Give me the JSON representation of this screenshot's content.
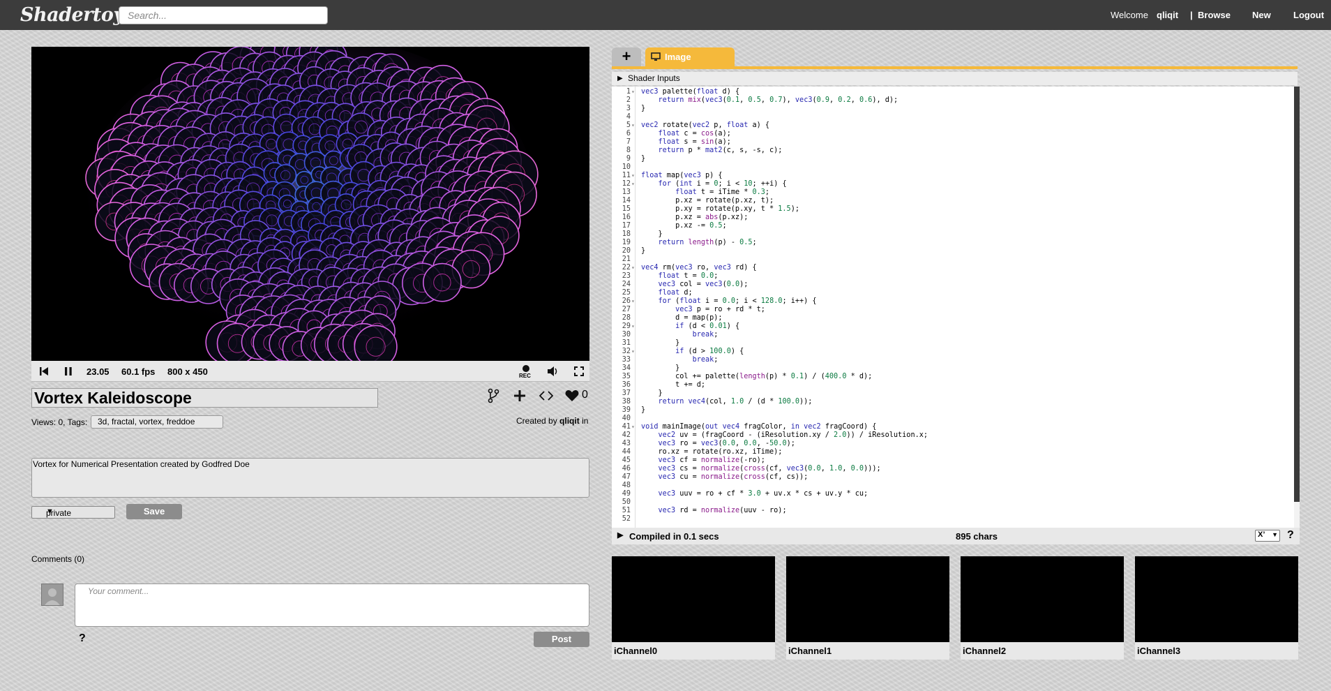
{
  "header": {
    "logo": "Shadertoy",
    "search_placeholder": "Search...",
    "welcome": "Welcome",
    "username": "qliqit",
    "separator": "|",
    "browse": "Browse",
    "new": "New",
    "logout": "Logout"
  },
  "player": {
    "time": "23.05",
    "fps": "60.1 fps",
    "resolution": "800 x 450",
    "rec_label": "REC"
  },
  "shader": {
    "title": "Vortex Kaleidoscope",
    "views_tags_label": "Views: 0, Tags:",
    "tags": "3d, fractal, vortex, freddoe",
    "likes": "0",
    "created_by_label": "Created by",
    "author": "qliqit",
    "created_in": "in",
    "description": "Vortex for Numerical Presentation created by Godfred Doe",
    "visibility": "private",
    "save_label": "Save"
  },
  "comments": {
    "header": "Comments (0)",
    "placeholder": "Your comment...",
    "help": "?",
    "post_label": "Post"
  },
  "editor": {
    "tab_add": "+",
    "tab_image": "Image",
    "shader_inputs": "Shader Inputs",
    "compiled": "Compiled in 0.1 secs",
    "chars": "895 chars",
    "font_select": "X’",
    "help": "?",
    "lines": [
      "vec3 palette(float d) {",
      "    return mix(vec3(0.1, 0.5, 0.7), vec3(0.9, 0.2, 0.6), d);",
      "}",
      "",
      "vec2 rotate(vec2 p, float a) {",
      "    float c = cos(a);",
      "    float s = sin(a);",
      "    return p * mat2(c, s, -s, c);",
      "}",
      "",
      "float map(vec3 p) {",
      "    for (int i = 0; i < 10; ++i) {",
      "        float t = iTime * 0.3;",
      "        p.xz = rotate(p.xz, t);",
      "        p.xy = rotate(p.xy, t * 1.5);",
      "        p.xz = abs(p.xz);",
      "        p.xz -= 0.5;",
      "    }",
      "    return length(p) - 0.5;",
      "}",
      "",
      "vec4 rm(vec3 ro, vec3 rd) {",
      "    float t = 0.0;",
      "    vec3 col = vec3(0.0);",
      "    float d;",
      "    for (float i = 0.0; i < 128.0; i++) {",
      "        vec3 p = ro + rd * t;",
      "        d = map(p);",
      "        if (d < 0.01) {",
      "            break;",
      "        }",
      "        if (d > 100.0) {",
      "            break;",
      "        }",
      "        col += palette(length(p) * 0.1) / (400.0 * d);",
      "        t += d;",
      "    }",
      "    return vec4(col, 1.0 / (d * 100.0));",
      "}",
      "",
      "void mainImage(out vec4 fragColor, in vec2 fragCoord) {",
      "    vec2 uv = (fragCoord - (iResolution.xy / 2.0)) / iResolution.x;",
      "    vec3 ro = vec3(0.0, 0.0, -50.0);",
      "    ro.xz = rotate(ro.xz, iTime);",
      "    vec3 cf = normalize(-ro);",
      "    vec3 cs = normalize(cross(cf, vec3(0.0, 1.0, 0.0)));",
      "    vec3 cu = normalize(cross(cf, cs));",
      "",
      "    vec3 uuv = ro + cf * 3.0 + uv.x * cs + uv.y * cu;",
      "",
      "    vec3 rd = normalize(uuv - ro);",
      ""
    ],
    "fold_lines": [
      1,
      5,
      11,
      12,
      22,
      26,
      29,
      32,
      41
    ]
  },
  "channels": [
    "iChannel0",
    "iChannel1",
    "iChannel2",
    "iChannel3"
  ],
  "colors": {
    "header_bg": "#3c3c3c",
    "tab_accent": "#f5b93b",
    "button_gray": "#8c8c8c"
  }
}
